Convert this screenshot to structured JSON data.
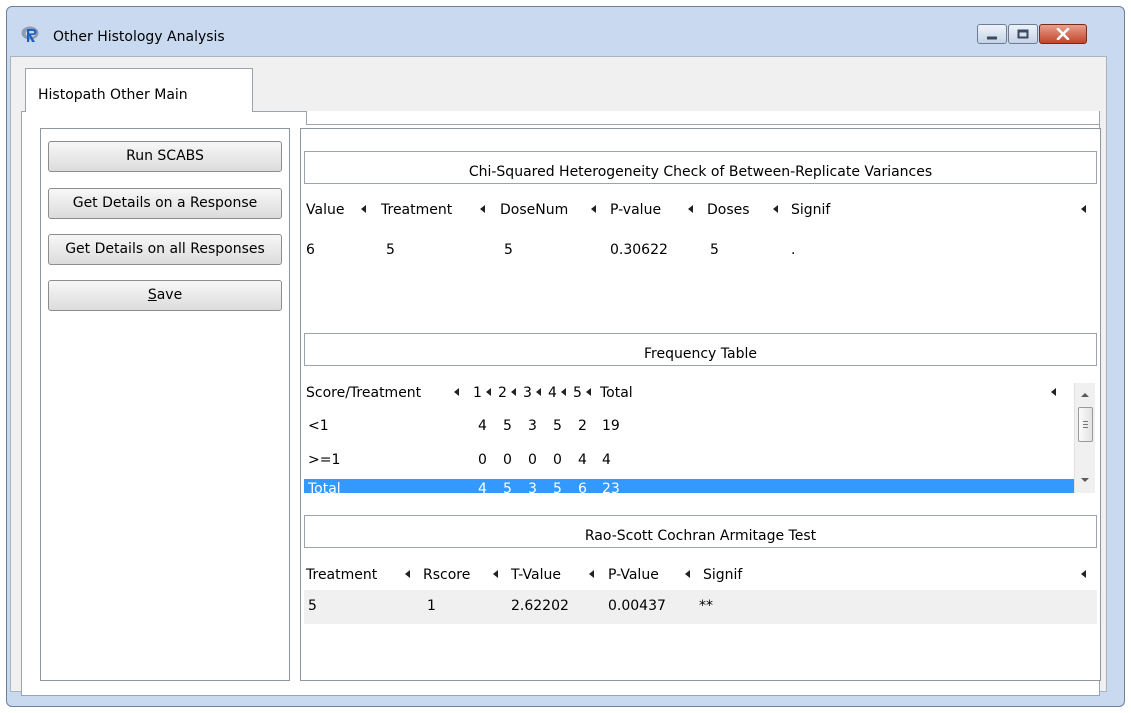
{
  "window": {
    "title": "Other Histology Analysis"
  },
  "tabs": [
    {
      "label": "Histopath Other Main"
    }
  ],
  "buttons": {
    "run": "Run SCABS",
    "details_one": "Get Details on a Response",
    "details_all": "Get Details on all Responses",
    "save_first": "S",
    "save_rest": "ave"
  },
  "chi": {
    "caption": "Chi-Squared Heterogeneity Check of Between-Replicate Variances",
    "columns": [
      "Value",
      "Treatment",
      "DoseNum",
      "P-value",
      "Doses",
      "Signif"
    ],
    "rows": [
      [
        "6",
        "5",
        "5",
        "0.30622",
        "5",
        "."
      ]
    ]
  },
  "freq": {
    "caption": "Frequency Table",
    "columns": [
      "Score/Treatment",
      "1",
      "2",
      "3",
      "4",
      "5",
      "Total"
    ],
    "rows": [
      [
        "<1",
        "4",
        "5",
        "3",
        "5",
        "2",
        "19"
      ],
      [
        ">=1",
        "0",
        "0",
        "0",
        "0",
        "4",
        "4"
      ],
      [
        "Total",
        "4",
        "5",
        "3",
        "5",
        "6",
        "23"
      ]
    ]
  },
  "rao": {
    "caption": "Rao-Scott Cochran Armitage Test",
    "columns": [
      "Treatment",
      "Rscore",
      "T-Value",
      "P-Value",
      "Signif"
    ],
    "rows": [
      [
        "5",
        "1",
        "2.62202",
        "0.00437",
        "**"
      ]
    ]
  },
  "icons": {
    "app": "r-logo-icon",
    "minimize": "minimize-icon",
    "maximize": "maximize-icon",
    "close": "close-icon",
    "sort": "sort-arrow-icon"
  },
  "colors": {
    "selection": "#3399ff",
    "title_bar": "#c9daf0",
    "close_button": "#c2442a"
  }
}
